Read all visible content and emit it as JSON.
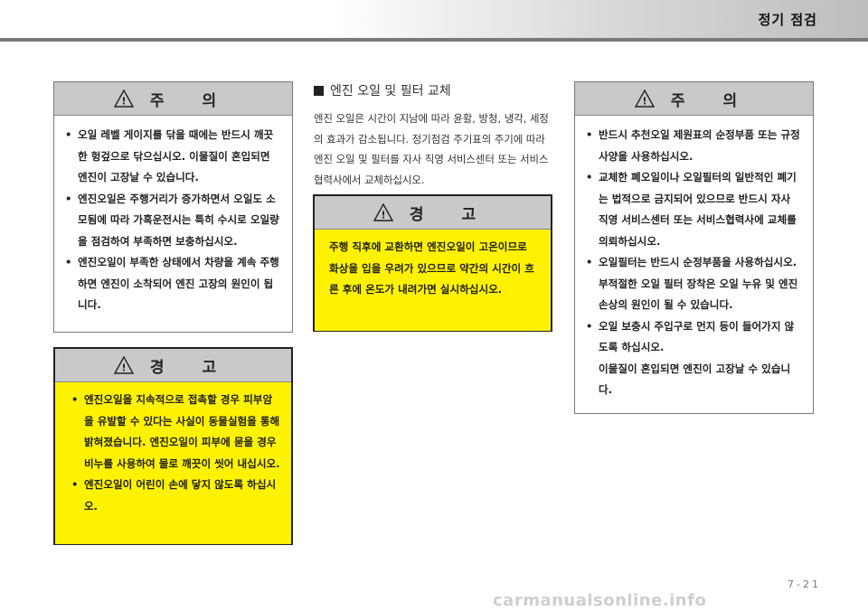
{
  "header": {
    "title": "정기 점검"
  },
  "left_caution": {
    "heading": "주 의",
    "items": [
      "오일 레벨 게이지를 닦을 때에는 반드시 깨끗한 헝겊으로 닦으십시오. 이물질이 혼입되면 엔진이 고장날 수 있습니다.",
      "엔진오일은 주행거리가 증가하면서 오일도 소모됨에 따라 가혹운전시는 특히 수시로 오일량을 점검하여 부족하면 보충하십시오.",
      "엔진오일이 부족한 상태에서 차량을 계속 주행하면 엔진이 소착되어 엔진 고장의 원인이 됩니다."
    ]
  },
  "left_warning": {
    "heading": "경 고",
    "items": [
      "엔진오일을 지속적으로 접촉할 경우 피부암을 유발할 수 있다는 사실이 동물실험을 통해 밝혀졌습니다. 엔진오일이 피부에 묻을 경우 비누를 사용하여 물로 깨끗이 씻어 내십시오.",
      "엔진오일이 어린이 손에 닿지 않도록 하십시오."
    ]
  },
  "middle": {
    "section_title": "엔진 오일 및 필터 교체",
    "paragraph": "엔진 오일은 시간이 지남에 따라 윤활, 방청, 냉각, 세정의 효과가 감소됩니다. 정기점검 주기표의 주기에 따라 엔진 오일 및 필터를 자사 직영 서비스센터 또는 서비스협력사에서 교체하십시오.",
    "warning": {
      "heading": "경 고",
      "text": "주행 직후에 교환하면 엔진오일이 고온이므로 화상을 입을 우려가 있으므로 약간의 시간이 흐른 후에 온도가 내려가면 실시하십시오."
    }
  },
  "right_caution": {
    "heading": "주 의",
    "items": [
      "반드시 추천오일 제원표의 순정부품 또는 규정사양을 사용하십시오.",
      "교체한 폐오일이나 오일필터의 일반적인 폐기는 법적으로 금지되어 있으므로 반드시 자사 직영 서비스센터 또는 서비스협력사에 교체를 의뢰하십시오.",
      "오일필터는 반드시 순정부품을 사용하십시오.",
      "부적절한 오일 필터 장착은 오일 누유 및 엔진 손상의 원인이 될 수 있습니다.",
      "오일 보충시 주입구로 먼지 등이 들어가지 않도록 하십시오.",
      "이물질이 혼입되면 엔진이 고장날 수 있습니다."
    ]
  },
  "footer": {
    "page_number": "7-21",
    "watermark": "carmanualsonline.info"
  },
  "icons": {
    "warning": "warning-triangle-icon"
  },
  "colors": {
    "warning_fill": "#fff200",
    "bar_gray": "#c9c9c9"
  }
}
